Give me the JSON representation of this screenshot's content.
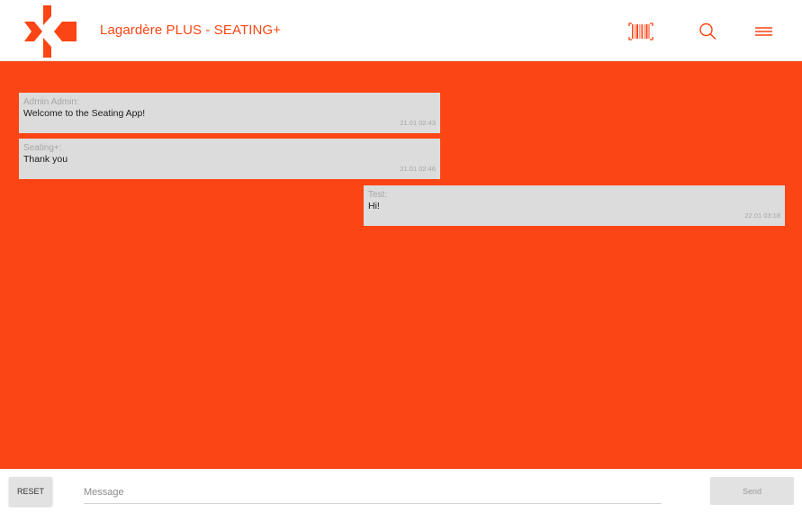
{
  "app": {
    "title": "Lagardère PLUS - SEATING+",
    "accent_color": "#fb4514"
  },
  "header": {
    "icons": [
      "logo-icon",
      "barcode-icon",
      "search-icon",
      "menu-icon"
    ]
  },
  "messages": [
    {
      "author": "Admin Admin:",
      "text": "Welcome to the Seating App!",
      "time": "21.01 02:43",
      "side": "left"
    },
    {
      "author": "Seating+:",
      "text": "Thank you",
      "time": "21.01 02:46",
      "side": "left"
    },
    {
      "author": "Test:",
      "text": "Hi!",
      "time": "22.01 03:18",
      "side": "right"
    }
  ],
  "footer": {
    "reset_label": "RESET",
    "message_placeholder": "Message",
    "message_value": "",
    "send_label": "Send"
  }
}
